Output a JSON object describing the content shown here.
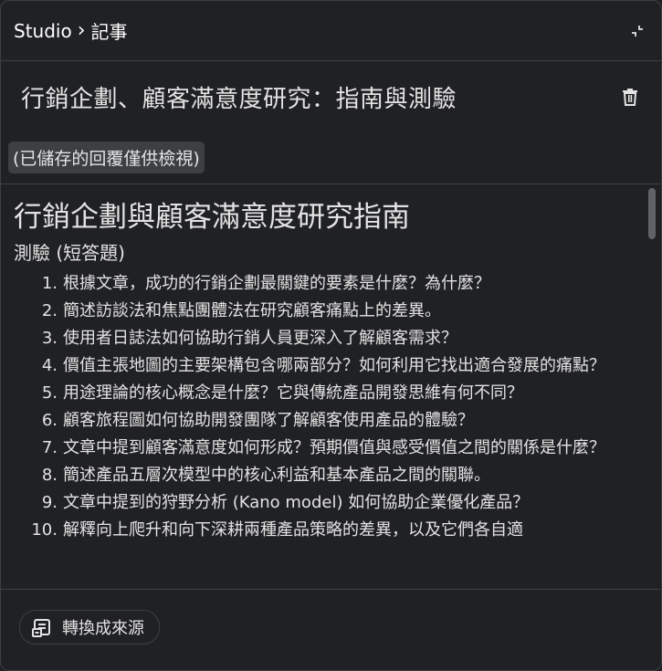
{
  "header": {
    "breadcrumb_root": "Studio",
    "breadcrumb_separator": "›",
    "breadcrumb_current": "記事",
    "collapse_icon": "collapse-icon"
  },
  "note": {
    "title": "行銷企劃、顧客滿意度研究：指南與測驗",
    "delete_icon": "trash-icon",
    "status_badge": "(已儲存的回覆僅供檢視)"
  },
  "content": {
    "doc_title": "行銷企劃與顧客滿意度研究指南",
    "section_title": "測驗 (短答題)",
    "questions": [
      {
        "num": "1.",
        "text": "根據文章，成功的行銷企劃最關鍵的要素是什麼？為什麼？"
      },
      {
        "num": "2.",
        "text": "簡述訪談法和焦點團體法在研究顧客痛點上的差異。"
      },
      {
        "num": "3.",
        "text": "使用者日誌法如何協助行銷人員更深入了解顧客需求？"
      },
      {
        "num": "4.",
        "text": "價值主張地圖的主要架構包含哪兩部分？如何利用它找出適合發展的痛點？"
      },
      {
        "num": "5.",
        "text": "用途理論的核心概念是什麼？它與傳統產品開發思維有何不同？"
      },
      {
        "num": "6.",
        "text": "顧客旅程圖如何協助開發團隊了解顧客使用產品的體驗？"
      },
      {
        "num": "7.",
        "text": "文章中提到顧客滿意度如何形成？預期價值與感受價值之間的關係是什麼？"
      },
      {
        "num": "8.",
        "text": "簡述產品五層次模型中的核心利益和基本產品之間的關聯。"
      },
      {
        "num": "9.",
        "text": "文章中提到的狩野分析 (Kano model) 如何協助企業優化產品？"
      },
      {
        "num": "10.",
        "text": "解釋向上爬升和向下深耕兩種產品策略的差異，以及它們各自適"
      }
    ]
  },
  "footer": {
    "convert_label": "轉換成來源",
    "convert_icon": "convert-source-icon"
  },
  "colors": {
    "background": "#202124",
    "border": "#3c4043",
    "text": "#e3e3e3",
    "badge_bg": "#3c4043"
  }
}
